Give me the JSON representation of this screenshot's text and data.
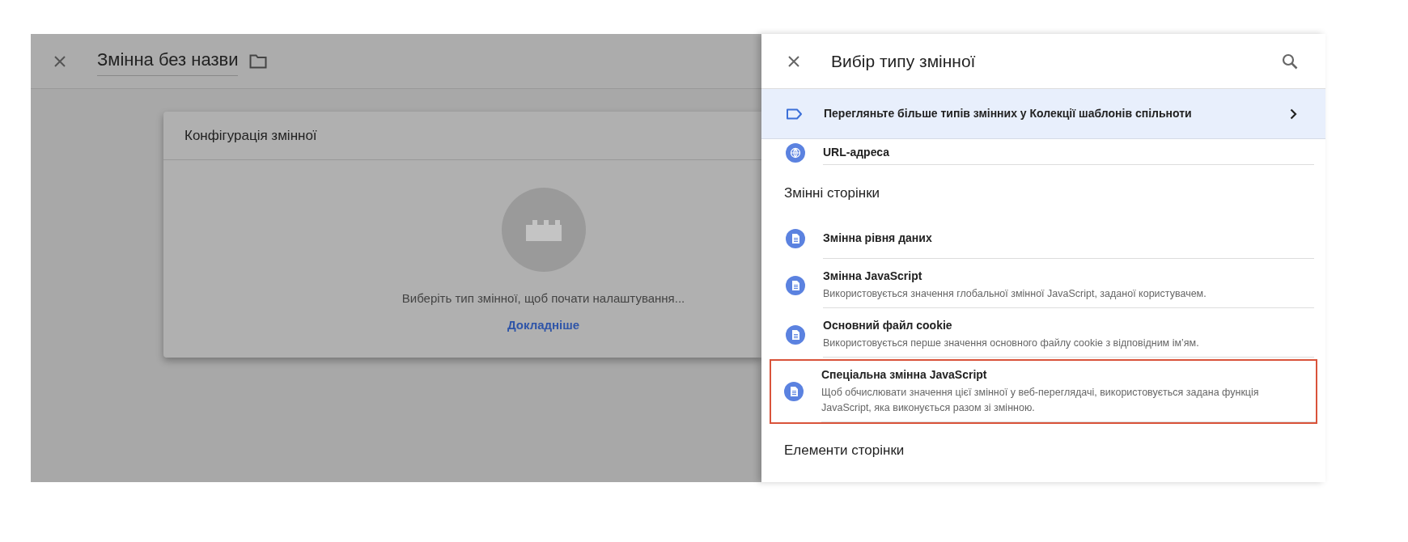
{
  "editor": {
    "title": "Змінна без назви",
    "card": {
      "title": "Конфігурація змінної",
      "prompt": "Виберіть тип змінної, щоб почати налаштування...",
      "link": "Докладніше"
    }
  },
  "picker": {
    "title": "Вибір типу змінної",
    "banner": "Перегляньте більше типів змінних у Колекції шаблонів спільноти",
    "entries": [
      {
        "kind": "address",
        "title": "URL-адреса",
        "highlighted": false
      },
      {
        "kind": "section",
        "title": "Змінні сторінки"
      },
      {
        "kind": "item",
        "title": "Змінна рівня даних",
        "highlighted": false
      },
      {
        "kind": "item",
        "title": "Змінна JavaScript",
        "description": "Використовується значення глобальної змінної JavaScript, заданої користувачем.",
        "highlighted": false
      },
      {
        "kind": "item",
        "title": "Основний файл cookie",
        "description": "Використовується перше значення основного файлу cookie з відповідним ім’ям.",
        "highlighted": false
      },
      {
        "kind": "item",
        "title": "Спеціальна змінна JavaScript",
        "description": "Щоб обчислювати значення цієї змінної у веб-переглядачі, використовується задана функція JavaScript, яка виконується разом зі змінною.",
        "highlighted": true
      },
      {
        "kind": "section",
        "title": "Елементи сторінки"
      }
    ]
  }
}
